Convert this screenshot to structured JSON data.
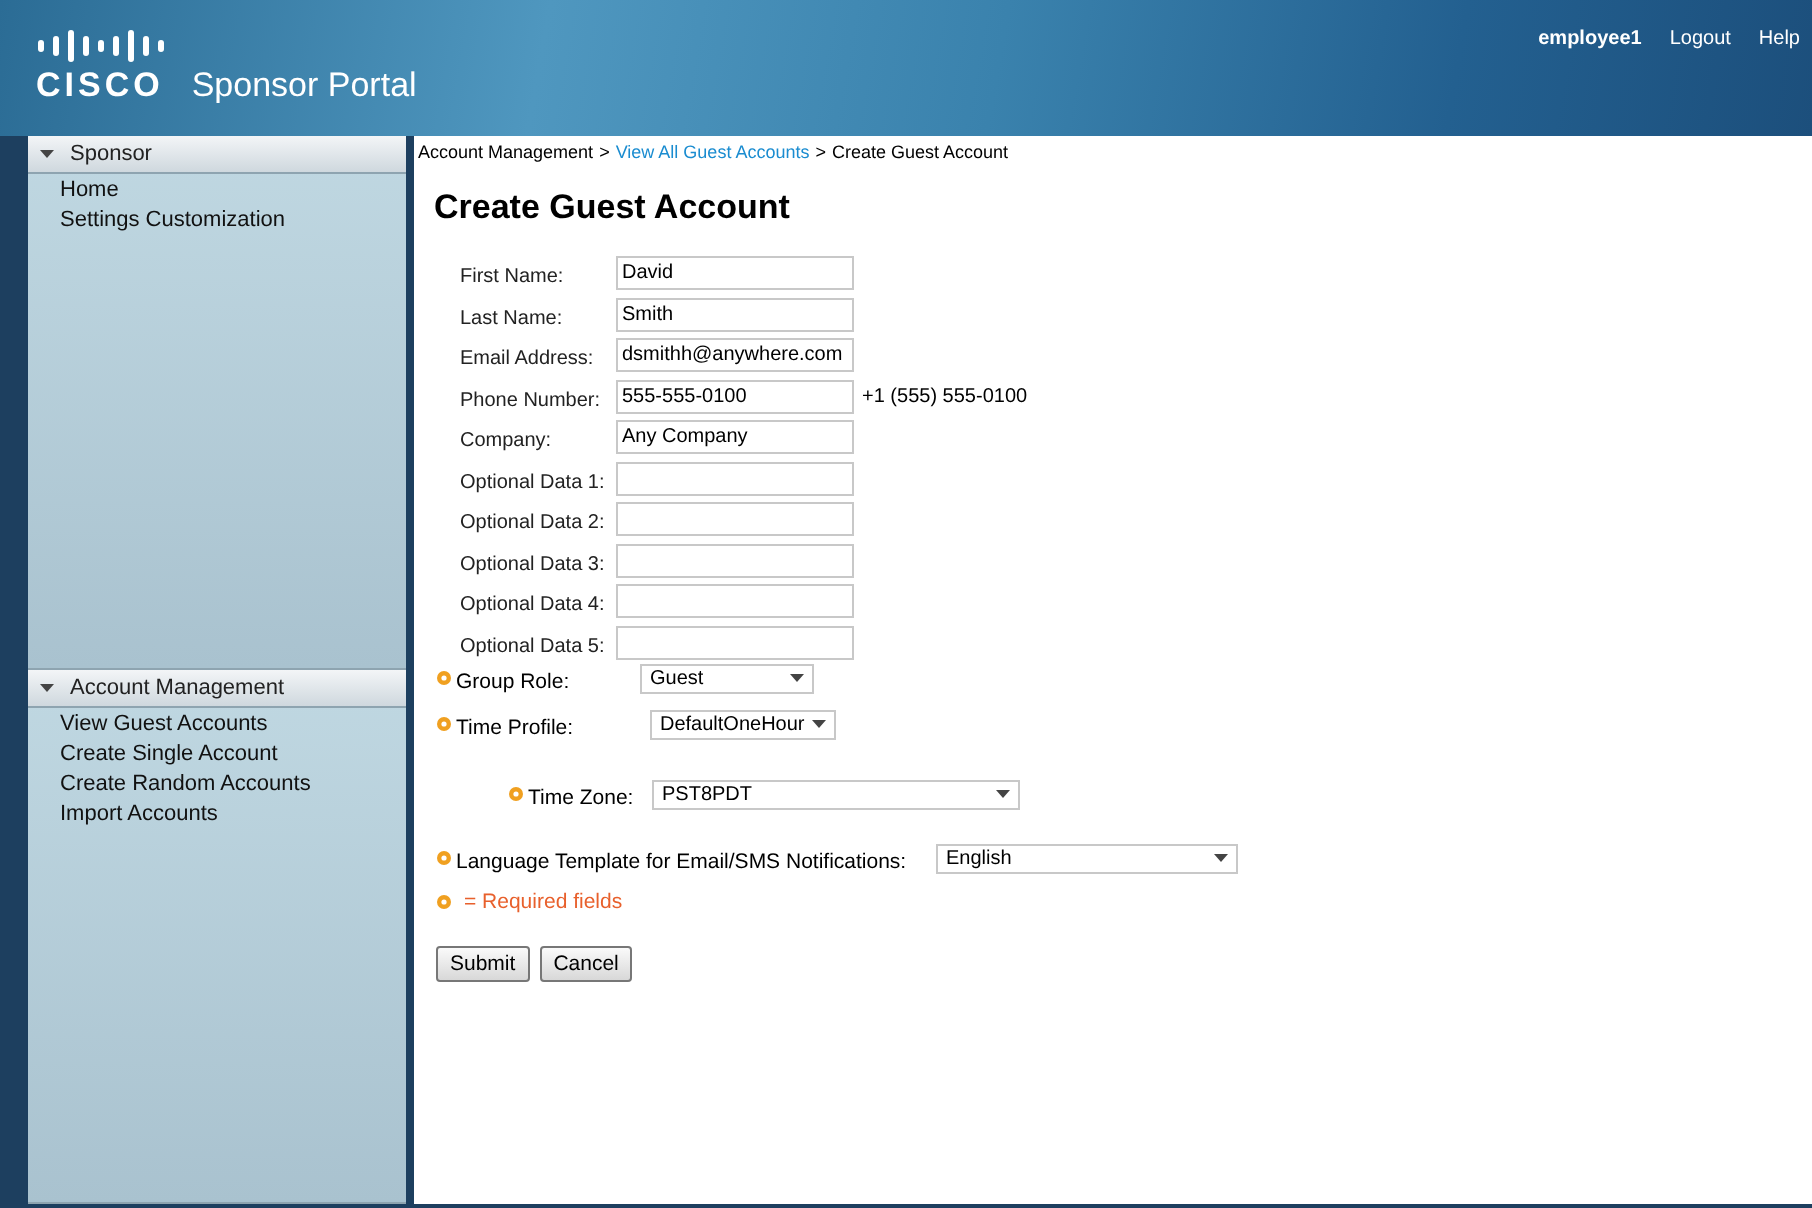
{
  "header": {
    "logo": "CISCO",
    "title": "Sponsor Portal",
    "user": "employee1",
    "links": [
      "Logout",
      "Help"
    ]
  },
  "sidebar": {
    "sections": [
      {
        "title": "Sponsor",
        "expanded": true,
        "items": [
          "Home",
          "Settings Customization"
        ]
      },
      {
        "title": "Account Management",
        "expanded": true,
        "items": [
          "View Guest Accounts",
          "Create Single Account",
          "Create Random Accounts",
          "Import Accounts"
        ]
      }
    ]
  },
  "breadcrumb": [
    {
      "kind": "item",
      "label": "Account Management",
      "link": false
    },
    {
      "kind": "separator",
      "label": ">"
    },
    {
      "kind": "item",
      "label": "View All Guest Accounts",
      "link": true
    },
    {
      "kind": "separator",
      "label": ">"
    },
    {
      "kind": "item",
      "label": "Create Guest Account",
      "link": false
    }
  ],
  "page_title": "Create Guest Account",
  "fields": [
    {
      "label": "First Name:",
      "value": "David"
    },
    {
      "label": "Last Name:",
      "value": "Smith"
    },
    {
      "label": "Email Address:",
      "value": "dsmithh@anywhere.com"
    },
    {
      "label": "Phone Number:",
      "value": "555-555-0100",
      "note": "+1 (555) 555-0100"
    },
    {
      "label": "Company:",
      "value": "Any Company"
    },
    {
      "label": "Optional Data 1:"
    },
    {
      "label": "Optional Data 2:"
    },
    {
      "label": "Optional Data 3:"
    },
    {
      "label": "Optional Data 4:"
    },
    {
      "label": "Optional Data 5:"
    }
  ],
  "selects": [
    {
      "label": "Group Role:",
      "value": "Guest",
      "required": true
    },
    {
      "label": "Time Profile:",
      "value": "DefaultOneHour",
      "required": true
    },
    {
      "label": "Time Zone:",
      "value": "PST8PDT",
      "required": true
    },
    {
      "label": "Language Template for Email/SMS Notifications:",
      "value": "English",
      "required": true
    }
  ],
  "required_note": "= Required fields",
  "buttons": [
    "Submit",
    "Cancel"
  ]
}
